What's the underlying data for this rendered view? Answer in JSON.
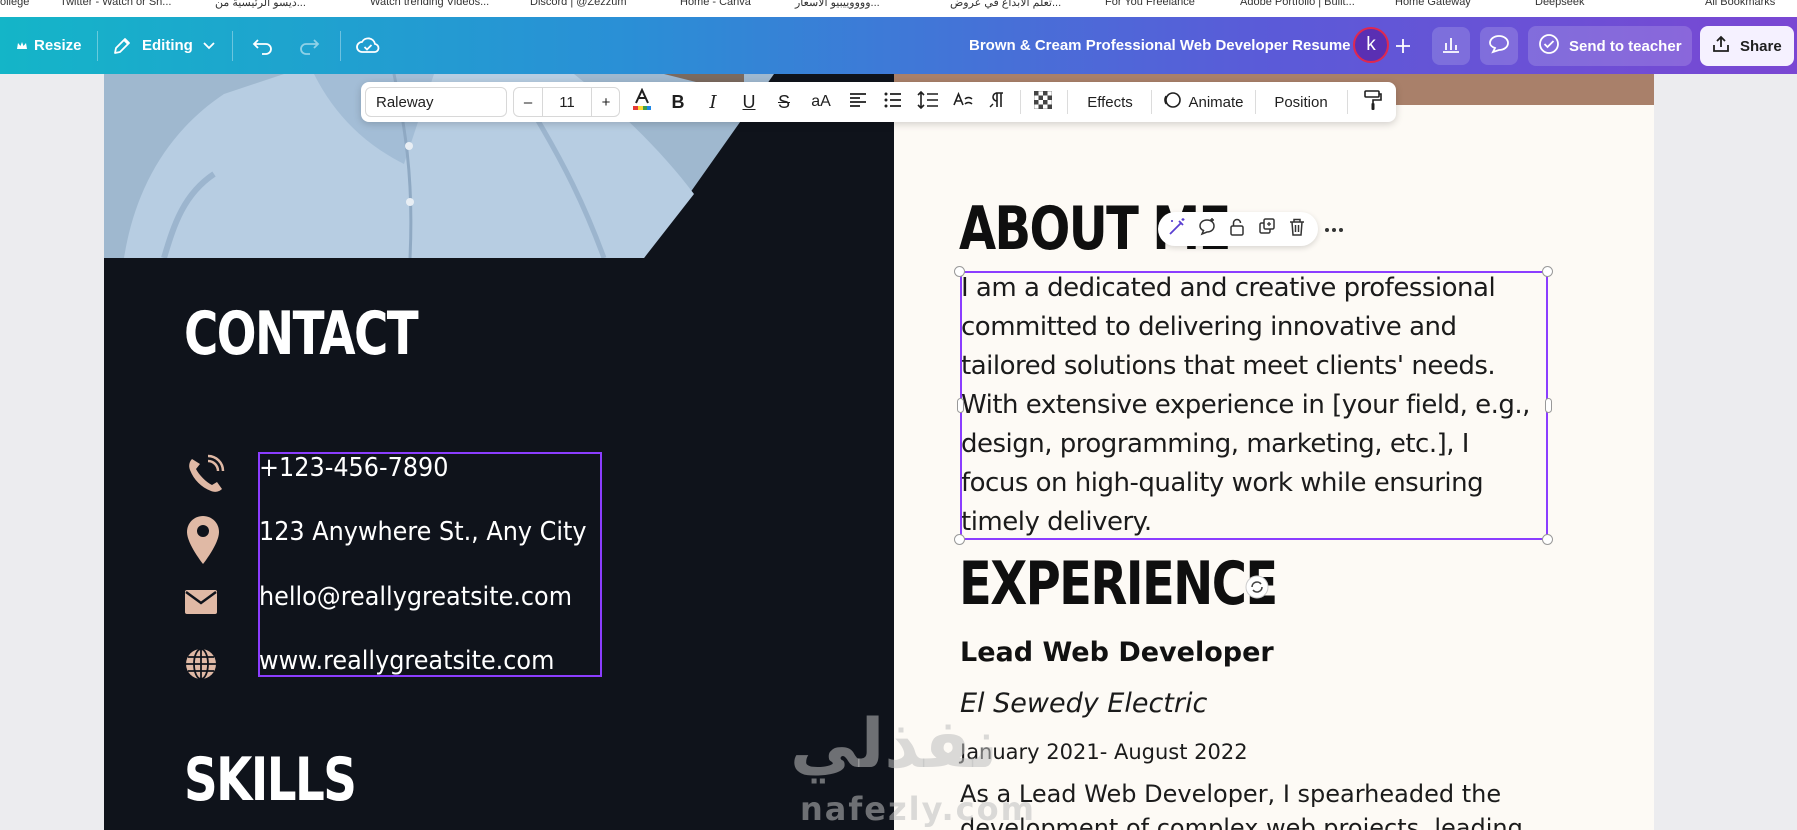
{
  "bookmarks": [
    "ollege",
    "Twitter - Watch or Sh...",
    "ديسو الرئيسية من...",
    "Watch trending Videos...",
    "Discord | @Zezzum",
    "Home - Canva",
    "ووووييبيو الاسعار...",
    "تعلم الابداع في عروض...",
    "For You Freelance",
    "Adobe Portfolio | Built...",
    "Home Gateway",
    "Deepseek",
    "All Bookmarks"
  ],
  "toolbar": {
    "resize_label": "Resize",
    "editing_label": "Editing",
    "document_title": "Brown & Cream Professional Web Developer Resume",
    "avatar_initial": "k",
    "send_to_teacher_label": "Send to teacher",
    "share_label": "Share"
  },
  "text_toolbar": {
    "font_name": "Raleway",
    "decrease_label": "–",
    "font_size": "11",
    "increase_label": "+",
    "bold_label": "B",
    "italic_label": "I",
    "underline_label": "U",
    "strike_label": "S",
    "case_label": "aA",
    "effects_label": "Effects",
    "animate_label": "Animate",
    "position_label": "Position"
  },
  "resume": {
    "contact_heading": "CONTACT",
    "contact_items": [
      "+123-456-7890",
      "123 Anywhere St., Any City",
      "hello@reallygreatsite.com",
      "www.reallygreatsite.com"
    ],
    "skills_heading": "SKILLS",
    "about_heading": "ABOUT ME",
    "about_text": "I am a dedicated and creative professional committed to delivering innovative and tailored solutions that meet clients' needs. With extensive experience in [your field, e.g., design, programming, marketing, etc.], I focus on high-quality work while ensuring timely delivery.",
    "experience_heading": "EXPERIENCE",
    "job_title": "Lead Web Developer",
    "company": "El Sewedy Electric",
    "dates": "January 2021- August 2022",
    "description_line1": "As a Lead Web Developer, I spearheaded the",
    "description_line2": "development of complex web projects, leading"
  },
  "watermark": {
    "arabic": "نفذلي",
    "latin": "nafezly.com"
  },
  "colors": {
    "accent_purple": "#8b3dff",
    "icon_tan": "#e0b9a5",
    "dark_panel": "#0f131b",
    "cream_panel": "#fdfaf5"
  }
}
